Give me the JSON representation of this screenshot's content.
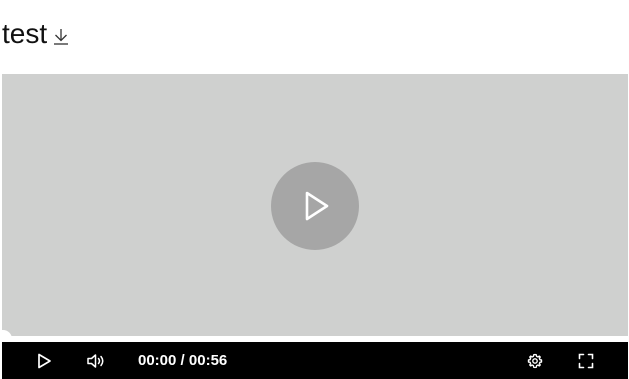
{
  "page": {
    "title": "test"
  },
  "player": {
    "current_time": "00:00",
    "separator": " / ",
    "duration": "00:56",
    "progress_fraction": 0.0,
    "colors": {
      "video_background": "#cfd0cf",
      "big_play_button": "#a6a6a6",
      "control_bar": "#000000",
      "progress_track": "#ffffff"
    },
    "icons": {
      "download": "download-icon",
      "big_play": "play-icon",
      "play": "play-icon",
      "volume": "volume-icon",
      "settings": "gear-icon",
      "fullscreen": "fullscreen-icon"
    }
  }
}
